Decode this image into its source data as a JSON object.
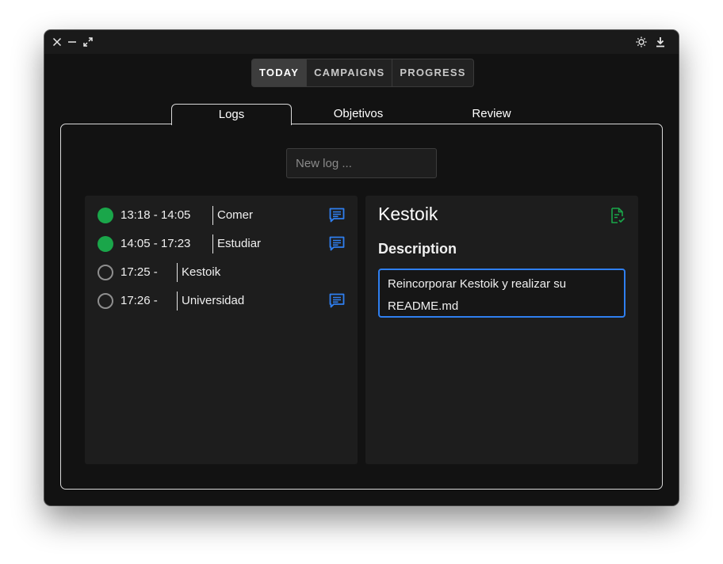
{
  "window_controls": {
    "close_icon": "close-icon",
    "minimize_icon": "minimize-icon",
    "expand_icon": "expand-icon",
    "theme_icon": "sun-icon",
    "download_icon": "download-icon"
  },
  "main_tabs": [
    {
      "label": "TODAY",
      "active": true
    },
    {
      "label": "CAMPAIGNS",
      "active": false
    },
    {
      "label": "PROGRESS",
      "active": false
    }
  ],
  "sub_tabs": [
    {
      "label": "Logs",
      "active": true
    },
    {
      "label": "Objetivos",
      "active": false
    },
    {
      "label": "Review",
      "active": false
    }
  ],
  "new_log": {
    "placeholder": "New log ...",
    "value": ""
  },
  "logs": [
    {
      "time": "13:18 - 14:05",
      "name": "Comer",
      "status": "done",
      "has_comment": true
    },
    {
      "time": "14:05 - 17:23",
      "name": "Estudiar",
      "status": "done",
      "has_comment": true
    },
    {
      "time": "17:25 - ",
      "name": "Kestoik",
      "status": "pending",
      "has_comment": false
    },
    {
      "time": "17:26 - ",
      "name": "Universidad",
      "status": "pending",
      "has_comment": true
    }
  ],
  "detail": {
    "title": "Kestoik",
    "description_heading": "Description",
    "description": "Reincorporar Kestoik y realizar su README.md"
  },
  "colors": {
    "done": "#1aa64a",
    "accent_blue": "#2f7ff0",
    "comment_icon": "#2f7ff0",
    "note_icon": "#1aa64a"
  }
}
